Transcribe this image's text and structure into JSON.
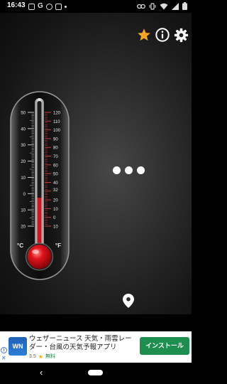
{
  "status_bar": {
    "time": "16:43",
    "left_icons": [
      "image-icon",
      "google-icon",
      "cloud-icon",
      "sd-icon",
      "dot-icon"
    ],
    "right_icons": [
      "link-icon",
      "vibrate-icon",
      "wifi-icon",
      "signal-icon",
      "battery-icon"
    ]
  },
  "toolbar": {
    "icons": [
      "star-icon",
      "info-icon",
      "gear-icon"
    ],
    "star_color": "#f5a623"
  },
  "thermometer": {
    "celsius_labels": [
      "50",
      "40",
      "30",
      "20",
      "10",
      "0",
      "10",
      "20"
    ],
    "fahrenheit_labels": [
      "120",
      "110",
      "100",
      "90",
      "80",
      "70",
      "60",
      "50",
      "40",
      "32",
      "20",
      "10",
      "0",
      "10"
    ],
    "celsius_unit": "°C",
    "fahrenheit_unit": "°F",
    "bulb_color": "#d0141c"
  },
  "menu": {
    "dots_icon": "more-dots-icon"
  },
  "location": {
    "icon": "location-pin-icon"
  },
  "ad": {
    "logo_text": "WN",
    "title": "ウェザーニュース 天気・雨雲レーダー・台風の天気予報アプリ",
    "rating": "3.5",
    "free_label": "無料",
    "install_label": "インストール",
    "info_glyph": "i",
    "close_glyph": "✕"
  },
  "nav_bar": {
    "back_glyph": "‹"
  }
}
